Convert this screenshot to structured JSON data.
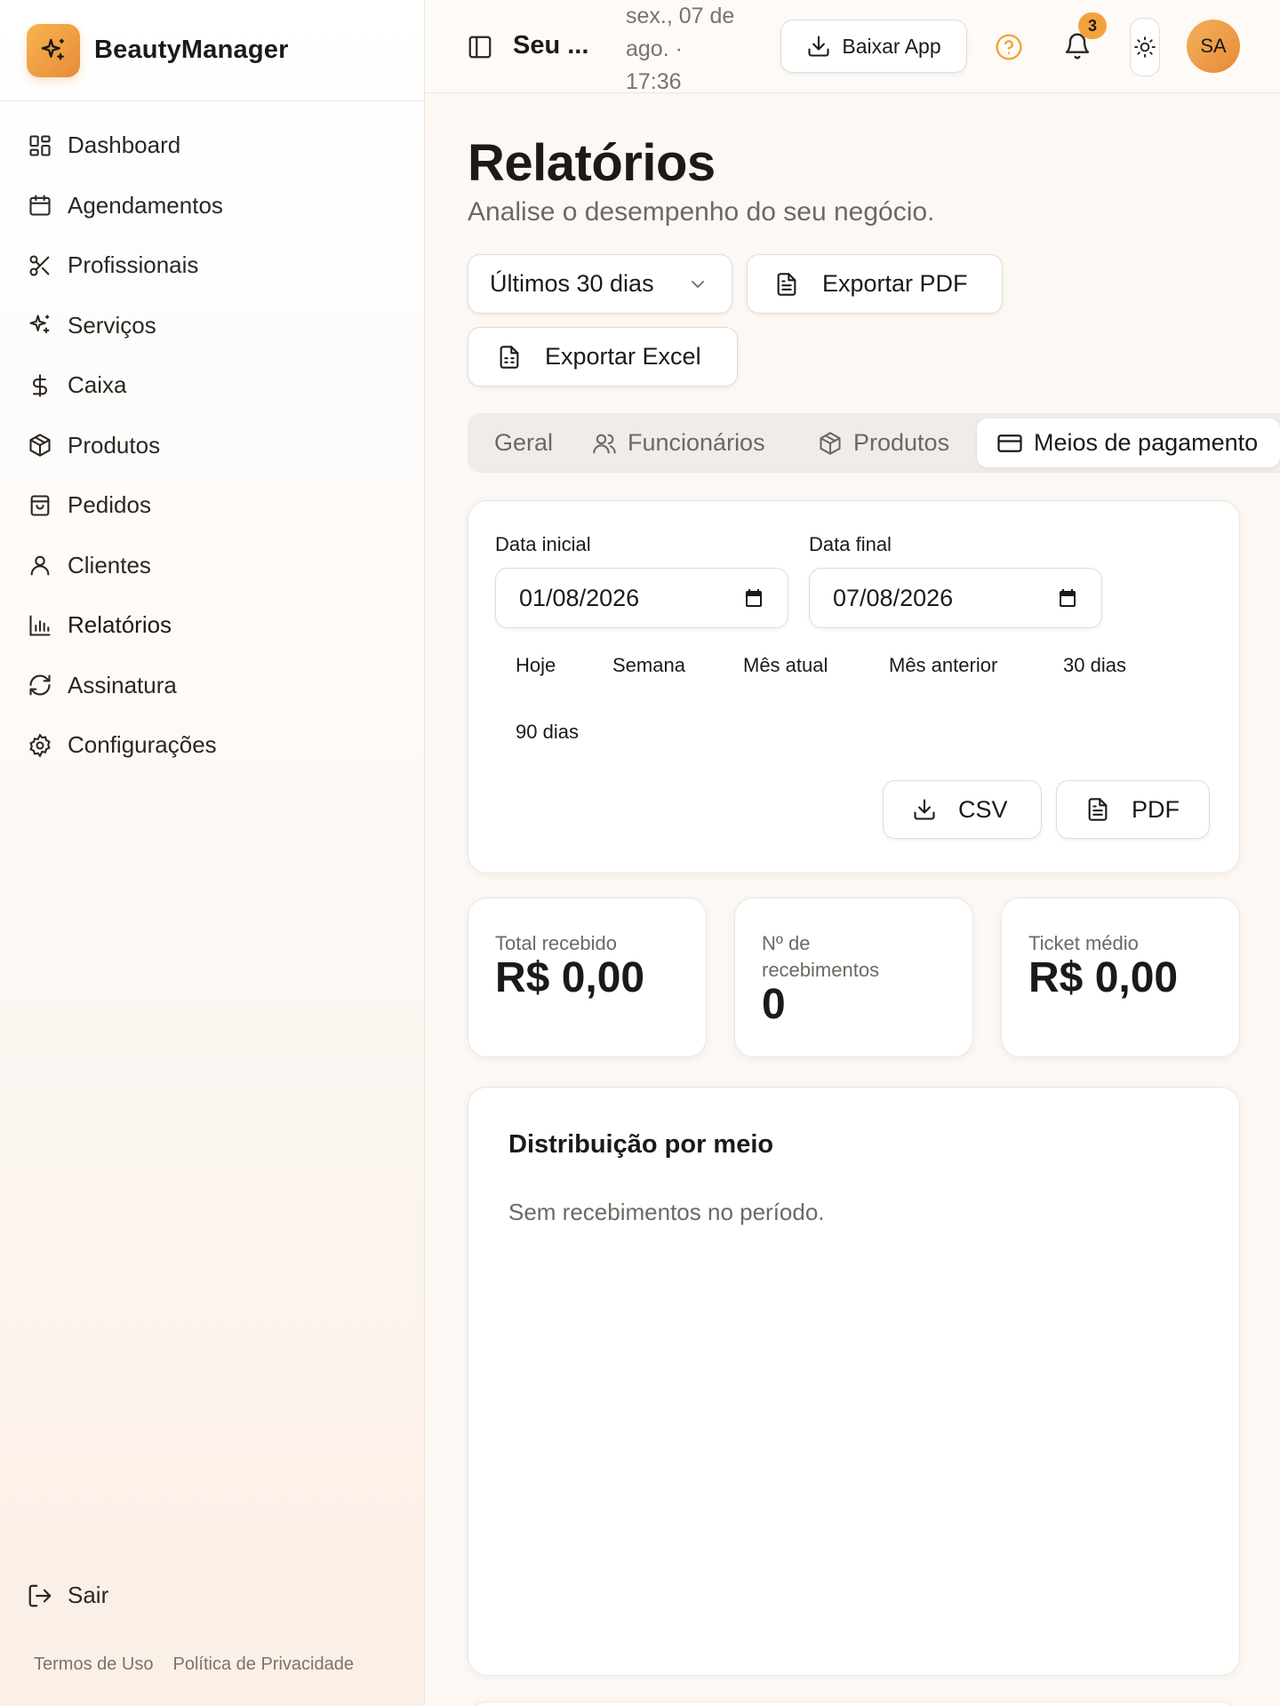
{
  "brand": {
    "name": "BeautyManager"
  },
  "sidebar": {
    "items": [
      {
        "label": "Dashboard",
        "icon": "grid-icon"
      },
      {
        "label": "Agendamentos",
        "icon": "calendar-icon"
      },
      {
        "label": "Profissionais",
        "icon": "scissors-icon"
      },
      {
        "label": "Serviços",
        "icon": "sparkles-icon"
      },
      {
        "label": "Caixa",
        "icon": "dollar-icon"
      },
      {
        "label": "Produtos",
        "icon": "package-icon"
      },
      {
        "label": "Pedidos",
        "icon": "shopping-bag-icon"
      },
      {
        "label": "Clientes",
        "icon": "user-icon"
      },
      {
        "label": "Relatórios",
        "icon": "bar-chart-icon",
        "active": true
      },
      {
        "label": "Assinatura",
        "icon": "refresh-icon"
      },
      {
        "label": "Configurações",
        "icon": "settings-icon"
      }
    ],
    "logout": "Sair",
    "footer": {
      "terms": "Termos de Uso",
      "privacy": "Política de Privacidade"
    }
  },
  "topbar": {
    "shop_name": "Seu ...",
    "datetime_lines": [
      "sex., 07 de",
      "ago. ·",
      "17:36"
    ],
    "download_app": "Baixar App",
    "notifications_count": "3",
    "avatar_initials": "SA"
  },
  "page": {
    "title": "Relatórios",
    "subtitle": "Analise o desempenho do seu negócio.",
    "period_select": "Últimos 30 dias",
    "export_pdf": "Exportar PDF",
    "export_excel": "Exportar Excel"
  },
  "tabs": [
    {
      "label": "Geral"
    },
    {
      "label": "Funcionários",
      "icon": "users-icon"
    },
    {
      "label": "Produtos",
      "icon": "package-icon"
    },
    {
      "label": "Meios de pagamento",
      "icon": "credit-card-icon",
      "active": true
    }
  ],
  "filters": {
    "start_label": "Data inicial",
    "start_value": "01/08/2026",
    "end_label": "Data final",
    "end_value": "07/08/2026",
    "quick_ranges": [
      "Hoje",
      "Semana",
      "Mês atual",
      "Mês anterior",
      "30 dias",
      "90 dias"
    ],
    "csv_label": "CSV",
    "pdf_label": "PDF"
  },
  "stats": [
    {
      "label": "Total recebido",
      "value": "R$ 0,00"
    },
    {
      "label": "Nº de recebimentos",
      "value": "0"
    },
    {
      "label": "Ticket médio",
      "value": "R$ 0,00"
    }
  ],
  "distribution": {
    "title": "Distribuição por meio",
    "empty_message": "Sem recebimentos no período."
  },
  "colors": {
    "accent": "#e8893a",
    "accent_light": "#f6b64e",
    "background": "#fdf8f4",
    "text": "#1c1a18",
    "muted": "#6f6862"
  }
}
